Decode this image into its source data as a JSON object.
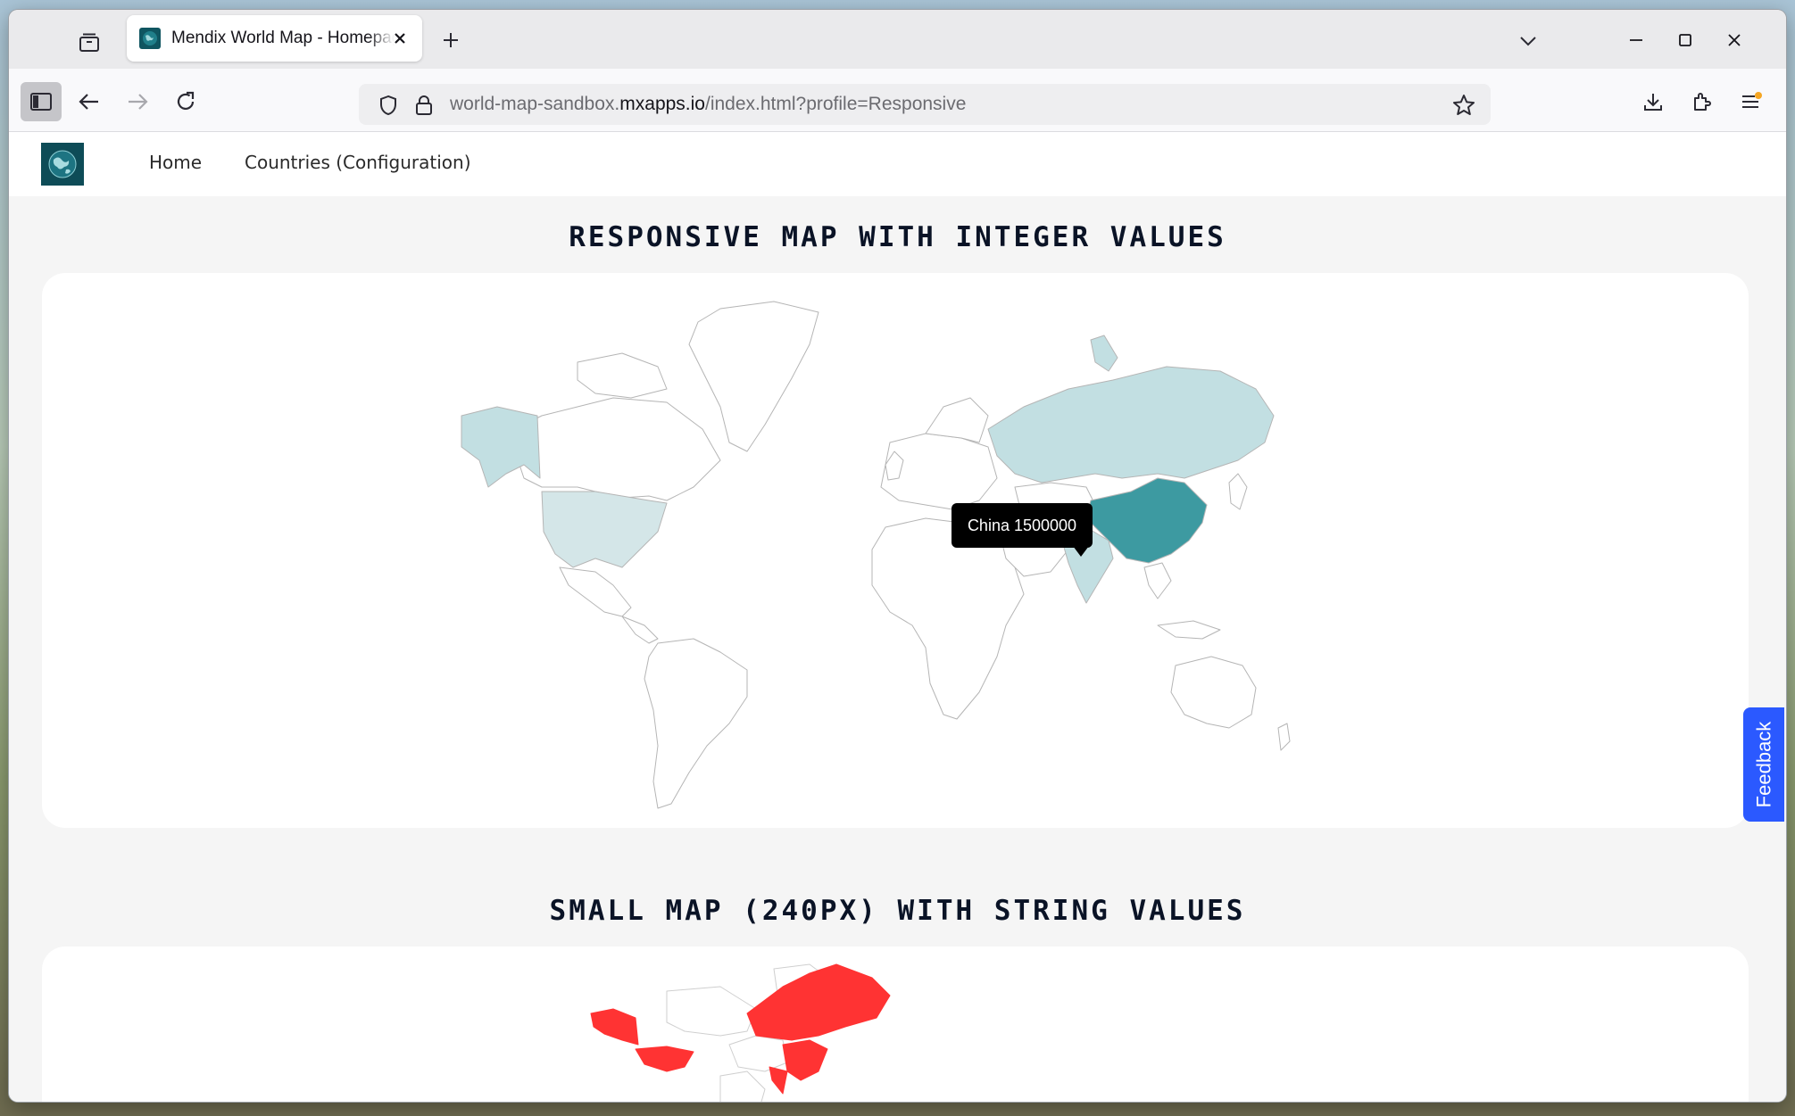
{
  "browser": {
    "tab": {
      "title": "Mendix World Map - Homepage"
    },
    "url": {
      "prefix": "world-map-sandbox.",
      "domain": "mxapps.io",
      "path": "/index.html?profile=Responsive"
    }
  },
  "app": {
    "nav": {
      "home": "Home",
      "countries": "Countries (Configuration)"
    }
  },
  "sections": [
    {
      "title": "RESPONSIVE MAP WITH INTEGER VALUES",
      "tooltip": "China 1500000",
      "colors": {
        "highlight": "#3d9aa1",
        "light": "#c2dfe2",
        "lighter": "#d4e6e8",
        "border": "#b5b5b5"
      }
    },
    {
      "title": "SMALL MAP (240PX) WITH STRING VALUES",
      "colors": {
        "highlight": "#ff3333"
      }
    }
  ],
  "feedback": {
    "label": "Feedback"
  }
}
